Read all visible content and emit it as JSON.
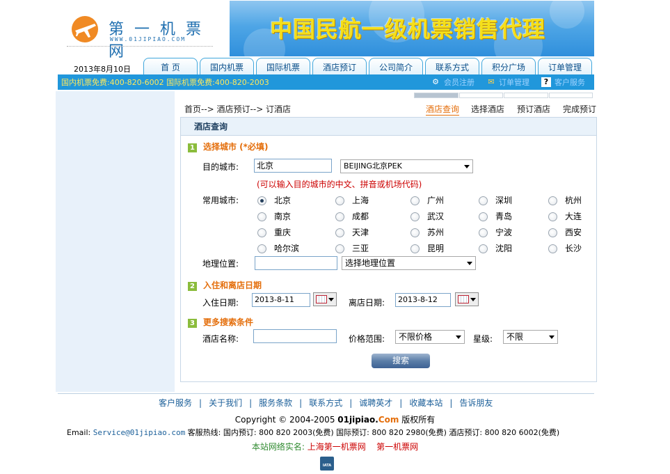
{
  "header": {
    "brand": "第 一 机 票 网",
    "domain": "WWW.01JIPIAO.COM",
    "slogan": "中国民航一级机票销售代理",
    "date": "2013年8月10日"
  },
  "nav": [
    "首  页",
    "国内机票",
    "国际机票",
    "酒店预订",
    "公司简介",
    "联系方式",
    "积分广场",
    "订单管理"
  ],
  "hotlines": {
    "text": "国内机票免费:400-820-6002 国际机票免费:400-820-2003",
    "member": "会员注册",
    "orders": "订单管理",
    "service": "客户服务"
  },
  "breadcrumb": "首页--> 酒店预订--> 订酒店",
  "steps": [
    "酒店查询",
    "选择酒店",
    "预订酒店",
    "完成预订"
  ],
  "form": {
    "title": "酒店查询",
    "section1": {
      "num": "1",
      "title": "选择城市 (*必填)"
    },
    "dest_label": "目的城市:",
    "dest_value": "北京",
    "dest_select": "BEIJING北京PEK",
    "hint": "(可以输入目的城市的中文、拼音或机场代码)",
    "common_label": "常用城市:",
    "cities": [
      "北京",
      "上海",
      "广州",
      "深圳",
      "杭州",
      "南京",
      "成都",
      "武汉",
      "青岛",
      "大连",
      "重庆",
      "天津",
      "苏州",
      "宁波",
      "西安",
      "哈尔滨",
      "三亚",
      "昆明",
      "沈阳",
      "长沙"
    ],
    "selected_city": "北京",
    "geo_label": "地理位置:",
    "geo_select": "选择地理位置",
    "section2": {
      "num": "2",
      "title": "入住和离店日期"
    },
    "checkin_label": "入住日期:",
    "checkin_value": "2013-8-11",
    "checkout_label": "离店日期:",
    "checkout_value": "2013-8-12",
    "section3": {
      "num": "3",
      "title": "更多搜索条件"
    },
    "hotel_label": "酒店名称:",
    "price_label": "价格范围:",
    "price_select": "不限价格",
    "star_label": "星级:",
    "star_select": "不限",
    "search_button": "搜索"
  },
  "footer": {
    "links": [
      "客户服务",
      "关于我们",
      "服务条款",
      "联系方式",
      "诚聘英才",
      "收藏本站",
      "告诉朋友"
    ],
    "separator": "|",
    "copyright_pre": "Copyright © 2004-2005 ",
    "copyright_site": "01jipiao.",
    "copyright_com": "Com",
    "copyright_post": " 版权所有",
    "email_label": "Email:",
    "email": "Service@01jipiao.com",
    "hotline_text": " 客服热线: 国内预订: 800 820 2003(免费) 国际预订: 800 820 2980(免费) 酒店预订: 800 820 6002(免费)",
    "realname_label": "本站网络实名: ",
    "realname_1": "上海第一机票网",
    "realname_2": "第一机票网",
    "iata": "IATA"
  }
}
